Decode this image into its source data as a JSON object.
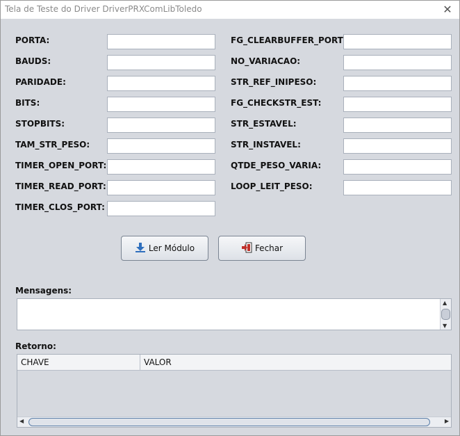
{
  "window": {
    "title": "Tela de Teste do Driver DriverPRXComLibToledo",
    "close_glyph": "✕"
  },
  "left_fields": [
    {
      "label": "PORTA:",
      "value": ""
    },
    {
      "label": "BAUDS:",
      "value": ""
    },
    {
      "label": "PARIDADE:",
      "value": ""
    },
    {
      "label": "BITS:",
      "value": ""
    },
    {
      "label": "STOPBITS:",
      "value": ""
    },
    {
      "label": "TAM_STR_PESO:",
      "value": ""
    },
    {
      "label": "TIMER_OPEN_PORT:",
      "value": ""
    },
    {
      "label": "TIMER_READ_PORT:",
      "value": ""
    },
    {
      "label": "TIMER_CLOS_PORT:",
      "value": ""
    }
  ],
  "right_fields": [
    {
      "label": "FG_CLEARBUFFER_PORT:",
      "value": ""
    },
    {
      "label": "NO_VARIACAO:",
      "value": ""
    },
    {
      "label": "STR_REF_INIPESO:",
      "value": ""
    },
    {
      "label": "FG_CHECKSTR_EST:",
      "value": ""
    },
    {
      "label": "STR_ESTAVEL:",
      "value": ""
    },
    {
      "label": "STR_INSTAVEL:",
      "value": ""
    },
    {
      "label": "QTDE_PESO_VARIA:",
      "value": ""
    },
    {
      "label": "LOOP_LEIT_PESO:",
      "value": ""
    }
  ],
  "buttons": {
    "read": {
      "label": "Ler Módulo",
      "icon": "download-icon"
    },
    "close": {
      "label": "Fechar",
      "icon": "exit-door-icon"
    }
  },
  "messages": {
    "label": "Mensagens:",
    "value": ""
  },
  "result": {
    "label": "Retorno:",
    "columns": [
      "CHAVE",
      "VALOR"
    ],
    "rows": []
  },
  "colors": {
    "background": "#d6d9df",
    "field_border": "#a9b0bb",
    "icon_blue": "#2f6fbd",
    "icon_red": "#c0302a"
  }
}
